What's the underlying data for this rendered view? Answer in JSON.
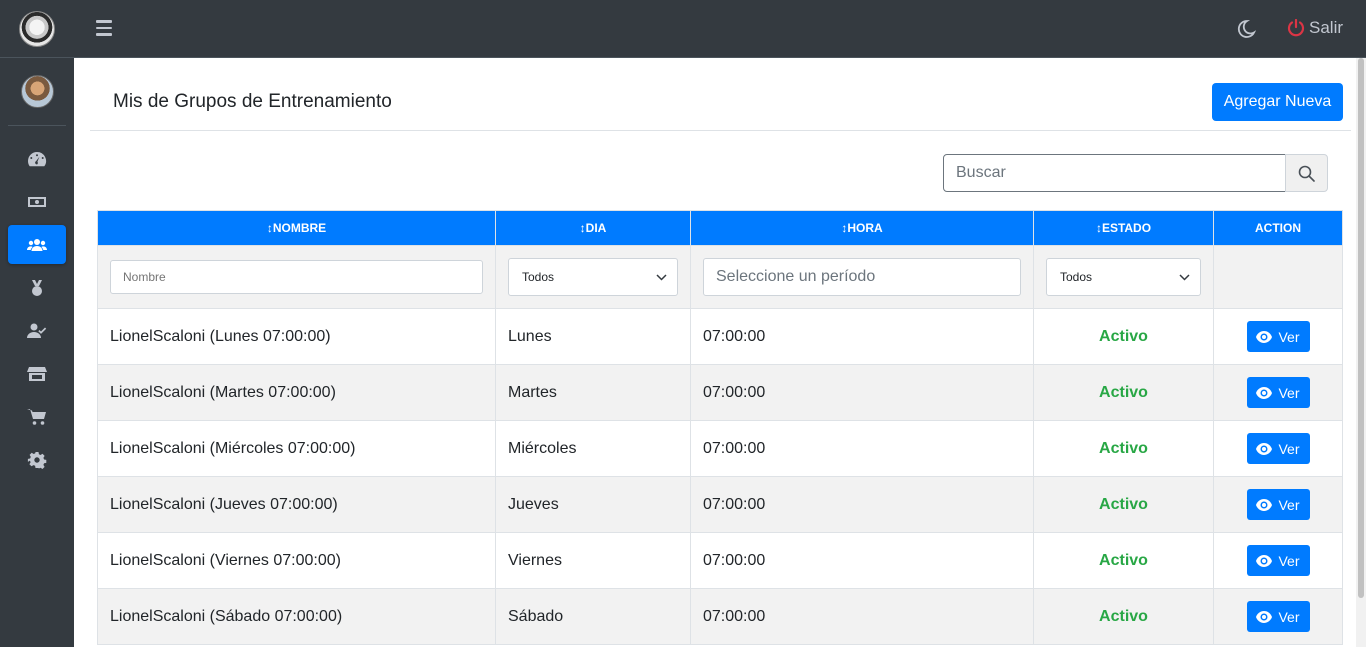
{
  "topbar": {
    "logout_label": "Salir"
  },
  "page": {
    "title": "Mis de Grupos de Entrenamiento",
    "add_button": "Agregar Nueva"
  },
  "search": {
    "placeholder": "Buscar"
  },
  "table": {
    "headers": [
      {
        "label": "NOMBRE",
        "sortable": true
      },
      {
        "label": "DIA",
        "sortable": true
      },
      {
        "label": "HORA",
        "sortable": true
      },
      {
        "label": "ESTADO",
        "sortable": true
      },
      {
        "label": "ACTION",
        "sortable": false
      }
    ],
    "filters": {
      "nombre_placeholder": "Nombre",
      "dia_selected": "Todos",
      "hora_placeholder": "Seleccione un período",
      "estado_selected": "Todos"
    },
    "rows": [
      {
        "nombre": "LionelScaloni (Lunes 07:00:00)",
        "dia": "Lunes",
        "hora": "07:00:00",
        "estado": "Activo",
        "action": "Ver"
      },
      {
        "nombre": "LionelScaloni (Martes 07:00:00)",
        "dia": "Martes",
        "hora": "07:00:00",
        "estado": "Activo",
        "action": "Ver"
      },
      {
        "nombre": "LionelScaloni (Miércoles 07:00:00)",
        "dia": "Miércoles",
        "hora": "07:00:00",
        "estado": "Activo",
        "action": "Ver"
      },
      {
        "nombre": "LionelScaloni (Jueves 07:00:00)",
        "dia": "Jueves",
        "hora": "07:00:00",
        "estado": "Activo",
        "action": "Ver"
      },
      {
        "nombre": "LionelScaloni (Viernes 07:00:00)",
        "dia": "Viernes",
        "hora": "07:00:00",
        "estado": "Activo",
        "action": "Ver"
      },
      {
        "nombre": "LionelScaloni (Sábado 07:00:00)",
        "dia": "Sábado",
        "hora": "07:00:00",
        "estado": "Activo",
        "action": "Ver"
      }
    ]
  },
  "sidebar": {
    "items": [
      {
        "icon": "dashboard-icon",
        "active": false
      },
      {
        "icon": "money-icon",
        "active": false
      },
      {
        "icon": "users-icon",
        "active": true
      },
      {
        "icon": "medal-icon",
        "active": false
      },
      {
        "icon": "user-check-icon",
        "active": false
      },
      {
        "icon": "store-icon",
        "active": false
      },
      {
        "icon": "cart-icon",
        "active": false
      },
      {
        "icon": "gear-icon",
        "active": false
      }
    ]
  },
  "colors": {
    "primary": "#007bff",
    "sidebar": "#343a40",
    "status_active": "#28a745",
    "danger": "#dc3545"
  }
}
